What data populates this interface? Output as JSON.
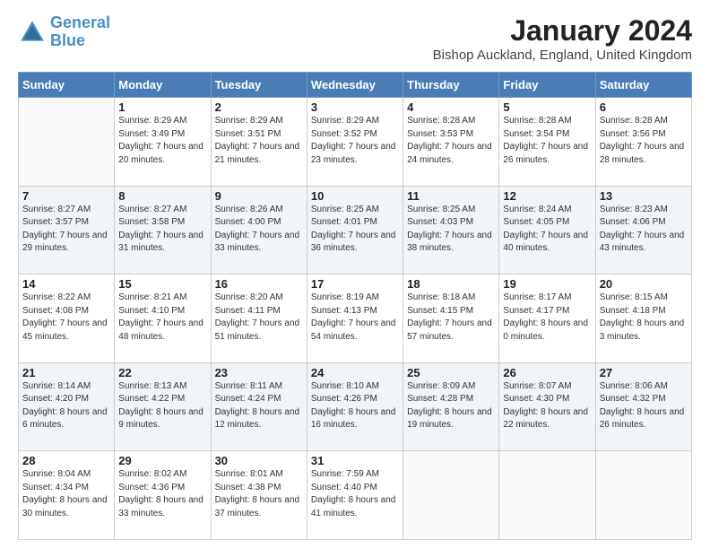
{
  "header": {
    "logo_line1": "General",
    "logo_line2": "Blue",
    "month": "January 2024",
    "location": "Bishop Auckland, England, United Kingdom"
  },
  "weekdays": [
    "Sunday",
    "Monday",
    "Tuesday",
    "Wednesday",
    "Thursday",
    "Friday",
    "Saturday"
  ],
  "weeks": [
    [
      {
        "day": "",
        "sunrise": "",
        "sunset": "",
        "daylight": ""
      },
      {
        "day": "1",
        "sunrise": "Sunrise: 8:29 AM",
        "sunset": "Sunset: 3:49 PM",
        "daylight": "Daylight: 7 hours and 20 minutes."
      },
      {
        "day": "2",
        "sunrise": "Sunrise: 8:29 AM",
        "sunset": "Sunset: 3:51 PM",
        "daylight": "Daylight: 7 hours and 21 minutes."
      },
      {
        "day": "3",
        "sunrise": "Sunrise: 8:29 AM",
        "sunset": "Sunset: 3:52 PM",
        "daylight": "Daylight: 7 hours and 23 minutes."
      },
      {
        "day": "4",
        "sunrise": "Sunrise: 8:28 AM",
        "sunset": "Sunset: 3:53 PM",
        "daylight": "Daylight: 7 hours and 24 minutes."
      },
      {
        "day": "5",
        "sunrise": "Sunrise: 8:28 AM",
        "sunset": "Sunset: 3:54 PM",
        "daylight": "Daylight: 7 hours and 26 minutes."
      },
      {
        "day": "6",
        "sunrise": "Sunrise: 8:28 AM",
        "sunset": "Sunset: 3:56 PM",
        "daylight": "Daylight: 7 hours and 28 minutes."
      }
    ],
    [
      {
        "day": "7",
        "sunrise": "Sunrise: 8:27 AM",
        "sunset": "Sunset: 3:57 PM",
        "daylight": "Daylight: 7 hours and 29 minutes."
      },
      {
        "day": "8",
        "sunrise": "Sunrise: 8:27 AM",
        "sunset": "Sunset: 3:58 PM",
        "daylight": "Daylight: 7 hours and 31 minutes."
      },
      {
        "day": "9",
        "sunrise": "Sunrise: 8:26 AM",
        "sunset": "Sunset: 4:00 PM",
        "daylight": "Daylight: 7 hours and 33 minutes."
      },
      {
        "day": "10",
        "sunrise": "Sunrise: 8:25 AM",
        "sunset": "Sunset: 4:01 PM",
        "daylight": "Daylight: 7 hours and 36 minutes."
      },
      {
        "day": "11",
        "sunrise": "Sunrise: 8:25 AM",
        "sunset": "Sunset: 4:03 PM",
        "daylight": "Daylight: 7 hours and 38 minutes."
      },
      {
        "day": "12",
        "sunrise": "Sunrise: 8:24 AM",
        "sunset": "Sunset: 4:05 PM",
        "daylight": "Daylight: 7 hours and 40 minutes."
      },
      {
        "day": "13",
        "sunrise": "Sunrise: 8:23 AM",
        "sunset": "Sunset: 4:06 PM",
        "daylight": "Daylight: 7 hours and 43 minutes."
      }
    ],
    [
      {
        "day": "14",
        "sunrise": "Sunrise: 8:22 AM",
        "sunset": "Sunset: 4:08 PM",
        "daylight": "Daylight: 7 hours and 45 minutes."
      },
      {
        "day": "15",
        "sunrise": "Sunrise: 8:21 AM",
        "sunset": "Sunset: 4:10 PM",
        "daylight": "Daylight: 7 hours and 48 minutes."
      },
      {
        "day": "16",
        "sunrise": "Sunrise: 8:20 AM",
        "sunset": "Sunset: 4:11 PM",
        "daylight": "Daylight: 7 hours and 51 minutes."
      },
      {
        "day": "17",
        "sunrise": "Sunrise: 8:19 AM",
        "sunset": "Sunset: 4:13 PM",
        "daylight": "Daylight: 7 hours and 54 minutes."
      },
      {
        "day": "18",
        "sunrise": "Sunrise: 8:18 AM",
        "sunset": "Sunset: 4:15 PM",
        "daylight": "Daylight: 7 hours and 57 minutes."
      },
      {
        "day": "19",
        "sunrise": "Sunrise: 8:17 AM",
        "sunset": "Sunset: 4:17 PM",
        "daylight": "Daylight: 8 hours and 0 minutes."
      },
      {
        "day": "20",
        "sunrise": "Sunrise: 8:15 AM",
        "sunset": "Sunset: 4:18 PM",
        "daylight": "Daylight: 8 hours and 3 minutes."
      }
    ],
    [
      {
        "day": "21",
        "sunrise": "Sunrise: 8:14 AM",
        "sunset": "Sunset: 4:20 PM",
        "daylight": "Daylight: 8 hours and 6 minutes."
      },
      {
        "day": "22",
        "sunrise": "Sunrise: 8:13 AM",
        "sunset": "Sunset: 4:22 PM",
        "daylight": "Daylight: 8 hours and 9 minutes."
      },
      {
        "day": "23",
        "sunrise": "Sunrise: 8:11 AM",
        "sunset": "Sunset: 4:24 PM",
        "daylight": "Daylight: 8 hours and 12 minutes."
      },
      {
        "day": "24",
        "sunrise": "Sunrise: 8:10 AM",
        "sunset": "Sunset: 4:26 PM",
        "daylight": "Daylight: 8 hours and 16 minutes."
      },
      {
        "day": "25",
        "sunrise": "Sunrise: 8:09 AM",
        "sunset": "Sunset: 4:28 PM",
        "daylight": "Daylight: 8 hours and 19 minutes."
      },
      {
        "day": "26",
        "sunrise": "Sunrise: 8:07 AM",
        "sunset": "Sunset: 4:30 PM",
        "daylight": "Daylight: 8 hours and 22 minutes."
      },
      {
        "day": "27",
        "sunrise": "Sunrise: 8:06 AM",
        "sunset": "Sunset: 4:32 PM",
        "daylight": "Daylight: 8 hours and 26 minutes."
      }
    ],
    [
      {
        "day": "28",
        "sunrise": "Sunrise: 8:04 AM",
        "sunset": "Sunset: 4:34 PM",
        "daylight": "Daylight: 8 hours and 30 minutes."
      },
      {
        "day": "29",
        "sunrise": "Sunrise: 8:02 AM",
        "sunset": "Sunset: 4:36 PM",
        "daylight": "Daylight: 8 hours and 33 minutes."
      },
      {
        "day": "30",
        "sunrise": "Sunrise: 8:01 AM",
        "sunset": "Sunset: 4:38 PM",
        "daylight": "Daylight: 8 hours and 37 minutes."
      },
      {
        "day": "31",
        "sunrise": "Sunrise: 7:59 AM",
        "sunset": "Sunset: 4:40 PM",
        "daylight": "Daylight: 8 hours and 41 minutes."
      },
      {
        "day": "",
        "sunrise": "",
        "sunset": "",
        "daylight": ""
      },
      {
        "day": "",
        "sunrise": "",
        "sunset": "",
        "daylight": ""
      },
      {
        "day": "",
        "sunrise": "",
        "sunset": "",
        "daylight": ""
      }
    ]
  ]
}
